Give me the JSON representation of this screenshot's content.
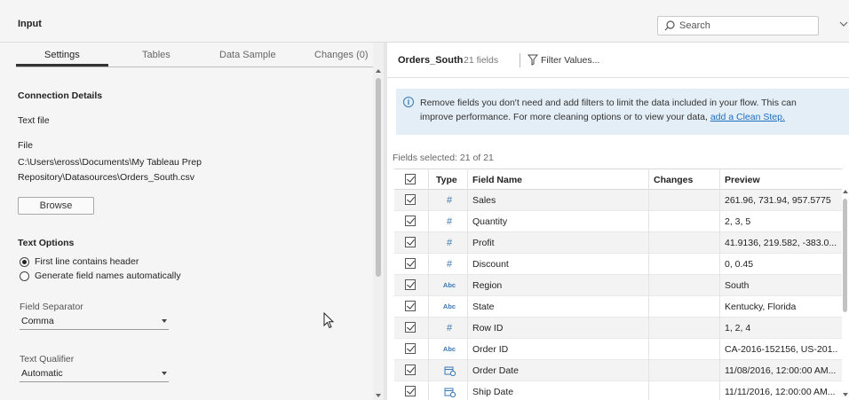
{
  "header": {
    "title": "Input",
    "search_placeholder": "Search"
  },
  "tabs": [
    {
      "label": "Settings",
      "active": true
    },
    {
      "label": "Tables",
      "active": false
    },
    {
      "label": "Data Sample",
      "active": false
    },
    {
      "label": "Changes (0)",
      "active": false
    }
  ],
  "settings": {
    "connection_details": "Connection Details",
    "connection_type": "Text file",
    "file_label": "File",
    "file_path_line1": "C:\\Users\\eross\\Documents\\My Tableau Prep",
    "file_path_line2": "Repository\\Datasources\\Orders_South.csv",
    "browse_label": "Browse",
    "text_options_label": "Text Options",
    "radio_header_label": "First line contains header",
    "radio_generate_label": "Generate field names automatically",
    "header_selected": true,
    "field_separator_label": "Field Separator",
    "field_separator_value": "Comma",
    "text_qualifier_label": "Text Qualifier",
    "text_qualifier_value": "Automatic"
  },
  "table_panel": {
    "name": "Orders_South",
    "field_count": "21 fields",
    "filter_label": "Filter Values...",
    "info_line1": "Remove fields you don't need and add filters to limit the data included in your flow. This can",
    "info_line2": "improve performance. For more cleaning options or to view your data,",
    "info_link": "add a Clean Step.",
    "fields_selected": "Fields selected: 21 of 21"
  },
  "grid": {
    "columns": {
      "type": "Type",
      "field_name": "Field Name",
      "changes": "Changes",
      "preview": "Preview"
    },
    "rows": [
      {
        "type": "#",
        "name": "Sales",
        "changes": "",
        "preview": "261.96, 731.94, 957.5775"
      },
      {
        "type": "#",
        "name": "Quantity",
        "changes": "",
        "preview": "2, 3, 5"
      },
      {
        "type": "#",
        "name": "Profit",
        "changes": "",
        "preview": "41.9136, 219.582, -383.0..."
      },
      {
        "type": "#",
        "name": "Discount",
        "changes": "",
        "preview": "0, 0.45"
      },
      {
        "type": "Abc",
        "name": "Region",
        "changes": "",
        "preview": "South"
      },
      {
        "type": "Abc",
        "name": "State",
        "changes": "",
        "preview": "Kentucky, Florida"
      },
      {
        "type": "#",
        "name": "Row ID",
        "changes": "",
        "preview": "1, 2, 4"
      },
      {
        "type": "Abc",
        "name": "Order ID",
        "changes": "",
        "preview": "CA-2016-152156, US-201..."
      },
      {
        "type": "date",
        "name": "Order Date",
        "changes": "",
        "preview": "11/08/2016, 12:00:00 AM..."
      },
      {
        "type": "date",
        "name": "Ship Date",
        "changes": "",
        "preview": "11/11/2016, 12:00:00 AM..."
      }
    ]
  },
  "colors": {
    "accent": "#3978b3",
    "info_bg": "#e4eef6",
    "link": "#1f6fbf"
  },
  "icons": [
    "search-icon",
    "chevron-down-icon",
    "filter-icon",
    "info-icon",
    "number-type-icon",
    "string-type-icon",
    "date-type-icon",
    "mouse-cursor-icon"
  ]
}
